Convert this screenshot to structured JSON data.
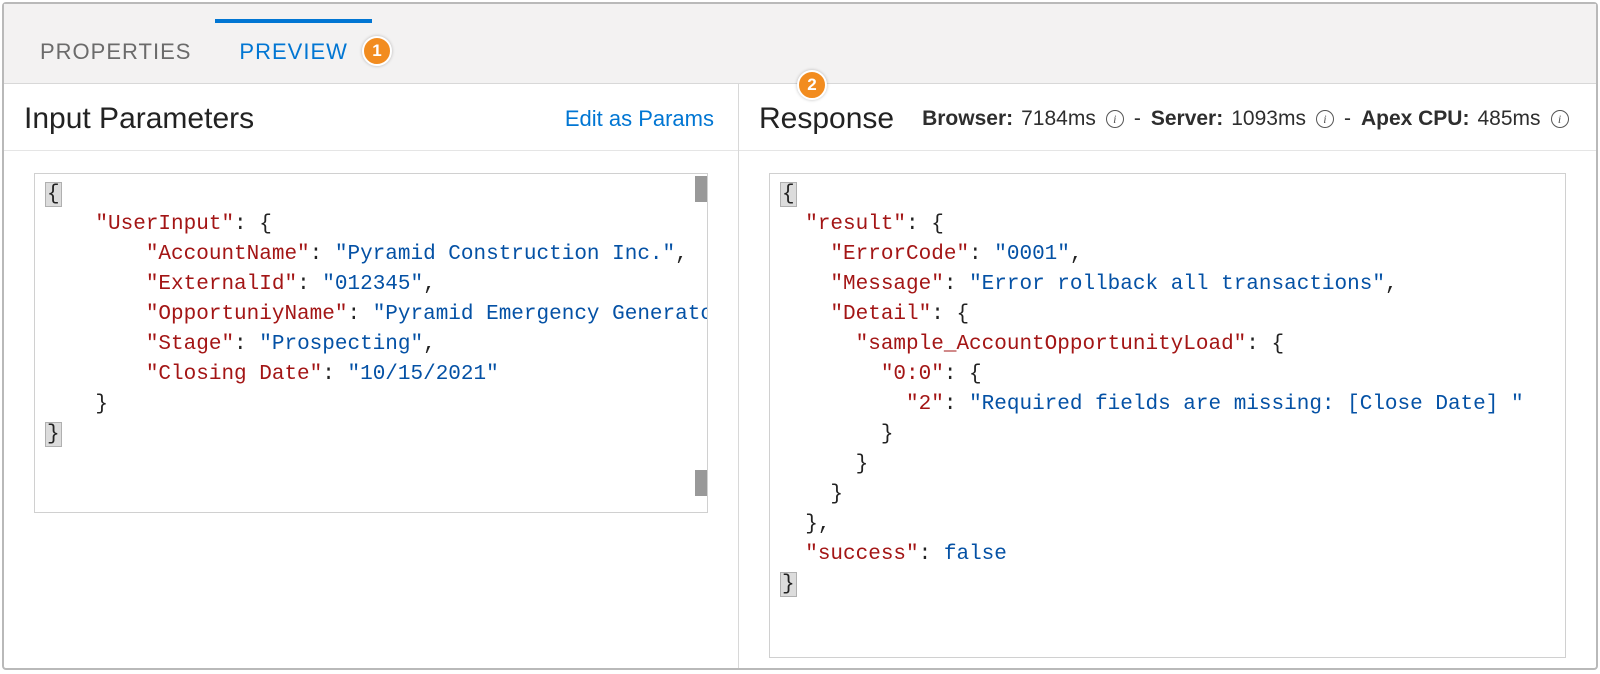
{
  "tabs": {
    "properties": "PROPERTIES",
    "preview": "PREVIEW"
  },
  "annotations": {
    "a1": "1",
    "a2": "2"
  },
  "left": {
    "title": "Input Parameters",
    "edit_link": "Edit as Params",
    "json": {
      "k_userinput": "\"UserInput\"",
      "k_accountname": "\"AccountName\"",
      "v_accountname": "\"Pyramid Construction Inc.\"",
      "k_externalid": "\"ExternalId\"",
      "v_externalid": "\"012345\"",
      "k_oppname": "\"OpportuniyName\"",
      "v_oppname": "\"Pyramid Emergency Generators\"",
      "k_stage": "\"Stage\"",
      "v_stage": "\"Prospecting\"",
      "k_closing": "\"Closing Date\"",
      "v_closing": "\"10/15/2021\""
    }
  },
  "right": {
    "title": "Response",
    "metrics": {
      "browser_label": "Browser:",
      "browser_value": "7184ms",
      "server_label": "Server:",
      "server_value": "1093ms",
      "apex_label": "Apex CPU:",
      "apex_value": "485ms",
      "sep": "-"
    },
    "json": {
      "k_result": "\"result\"",
      "k_errorcode": "\"ErrorCode\"",
      "v_errorcode": "\"0001\"",
      "k_message": "\"Message\"",
      "v_message": "\"Error rollback all transactions\"",
      "k_detail": "\"Detail\"",
      "k_sample": "\"sample_AccountOpportunityLoad\"",
      "k_00": "\"0:0\"",
      "k_2": "\"2\"",
      "v_2": "\"Required fields are missing: [Close Date] \"",
      "k_success": "\"success\"",
      "v_success": "false"
    }
  }
}
